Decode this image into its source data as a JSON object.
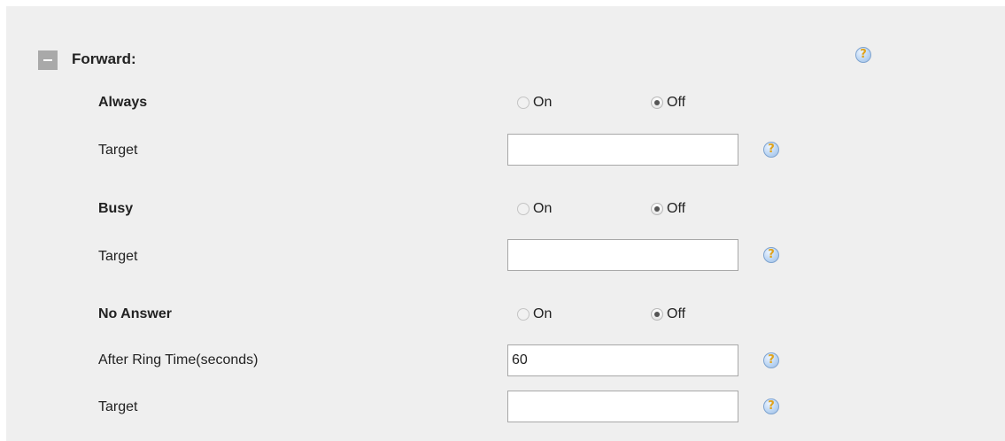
{
  "section": {
    "title": "Forward:"
  },
  "radio_labels": {
    "on": "On",
    "off": "Off"
  },
  "always": {
    "label": "Always",
    "selected": "Off",
    "target_label": "Target",
    "target_value": ""
  },
  "busy": {
    "label": "Busy",
    "selected": "Off",
    "target_label": "Target",
    "target_value": ""
  },
  "no_answer": {
    "label": "No Answer",
    "selected": "Off",
    "ring_time_label": "After Ring Time(seconds)",
    "ring_time_value": "60",
    "target_label": "Target",
    "target_value": ""
  },
  "icons": {
    "collapse": "minus-icon",
    "help": "help-question-icon"
  }
}
